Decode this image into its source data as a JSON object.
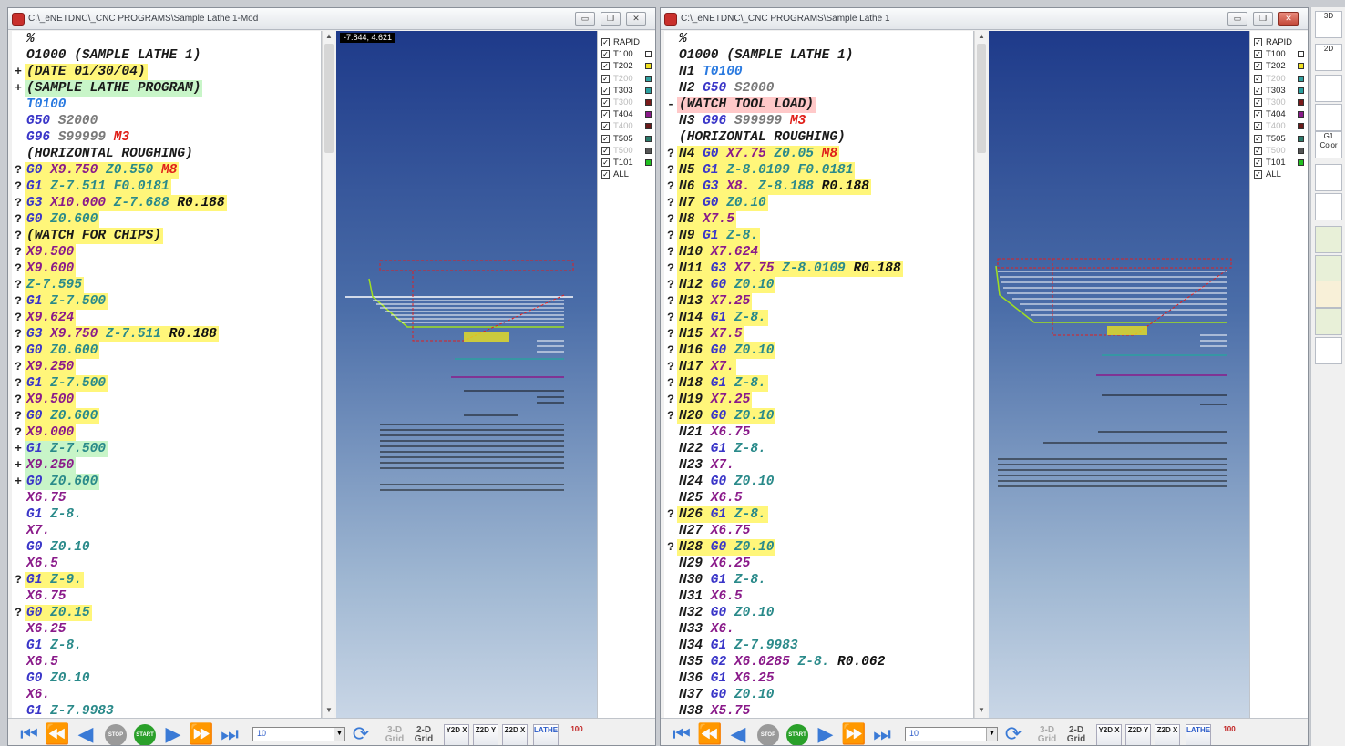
{
  "left": {
    "title": "C:\\_eNETDNC\\_CNC PROGRAMS\\Sample Lathe 1-Mod",
    "coord": "-7.844, 4.621",
    "code": [
      {
        "g": "",
        "t": [
          [
            "%",
            "t"
          ]
        ]
      },
      {
        "g": "",
        "t": [
          [
            "O1000 (SAMPLE LATHE 1)",
            "t"
          ]
        ]
      },
      {
        "g": "+",
        "h": "yellow",
        "t": [
          [
            "(DATE 01/30/04)",
            "t"
          ]
        ]
      },
      {
        "g": "+",
        "h": "green",
        "t": [
          [
            "(SAMPLE LATHE PROGRAM)",
            "t"
          ]
        ]
      },
      {
        "g": "",
        "t": [
          [
            "T0100",
            "tool"
          ]
        ]
      },
      {
        "g": "",
        "t": [
          [
            "G50",
            "g"
          ],
          [
            " S2000",
            "s"
          ]
        ]
      },
      {
        "g": "",
        "t": [
          [
            "G96",
            "g"
          ],
          [
            " S99999",
            "s"
          ],
          [
            " M3",
            "m"
          ]
        ]
      },
      {
        "g": "",
        "t": [
          [
            "(HORIZONTAL ROUGHING)",
            "t"
          ]
        ]
      },
      {
        "g": "?",
        "h": "yellow",
        "t": [
          [
            "G0",
            "g"
          ],
          [
            " X9.750",
            "x"
          ],
          [
            " Z0.550",
            "z"
          ],
          [
            " M8",
            "m"
          ]
        ]
      },
      {
        "g": "?",
        "h": "yellow",
        "t": [
          [
            "G1",
            "g"
          ],
          [
            " Z-7.511",
            "z"
          ],
          [
            " F0.0181",
            "f"
          ]
        ]
      },
      {
        "g": "?",
        "h": "yellow",
        "t": [
          [
            "G3",
            "g"
          ],
          [
            " X10.000",
            "x"
          ],
          [
            " Z-7.688",
            "z"
          ],
          [
            " R0.188",
            "r"
          ]
        ]
      },
      {
        "g": "?",
        "h": "yellow",
        "t": [
          [
            "G0",
            "g"
          ],
          [
            " Z0.600",
            "z"
          ]
        ]
      },
      {
        "g": "?",
        "h": "yellow",
        "t": [
          [
            "(WATCH FOR CHIPS)",
            "t"
          ]
        ]
      },
      {
        "g": "?",
        "h": "yellow",
        "t": [
          [
            "X9.500",
            "x"
          ]
        ]
      },
      {
        "g": "?",
        "h": "yellow",
        "t": [
          [
            "X9.600",
            "x"
          ]
        ]
      },
      {
        "g": "?",
        "h": "yellow",
        "t": [
          [
            "Z-7.595",
            "z"
          ]
        ]
      },
      {
        "g": "?",
        "h": "yellow",
        "t": [
          [
            "G1",
            "g"
          ],
          [
            " Z-7.500",
            "z"
          ]
        ]
      },
      {
        "g": "?",
        "h": "yellow",
        "t": [
          [
            "X9.624",
            "x"
          ]
        ]
      },
      {
        "g": "?",
        "h": "yellow",
        "t": [
          [
            "G3",
            "g"
          ],
          [
            " X9.750",
            "x"
          ],
          [
            " Z-7.511",
            "z"
          ],
          [
            " R0.188",
            "r"
          ]
        ]
      },
      {
        "g": "?",
        "h": "yellow",
        "t": [
          [
            "G0",
            "g"
          ],
          [
            " Z0.600",
            "z"
          ]
        ]
      },
      {
        "g": "?",
        "h": "yellow",
        "t": [
          [
            "X9.250",
            "x"
          ]
        ]
      },
      {
        "g": "?",
        "h": "yellow",
        "t": [
          [
            "G1",
            "g"
          ],
          [
            " Z-7.500",
            "z"
          ]
        ]
      },
      {
        "g": "?",
        "h": "yellow",
        "t": [
          [
            "X9.500",
            "x"
          ]
        ]
      },
      {
        "g": "?",
        "h": "yellow",
        "t": [
          [
            "G0",
            "g"
          ],
          [
            " Z0.600",
            "z"
          ]
        ]
      },
      {
        "g": "?",
        "h": "yellow",
        "t": [
          [
            "X9.000",
            "x"
          ]
        ]
      },
      {
        "g": "+",
        "h": "green",
        "t": [
          [
            "G1",
            "g"
          ],
          [
            " Z-7.500",
            "z"
          ]
        ]
      },
      {
        "g": "+",
        "h": "green",
        "t": [
          [
            "X9.250",
            "x"
          ]
        ]
      },
      {
        "g": "+",
        "h": "green",
        "t": [
          [
            "G0",
            "g"
          ],
          [
            " Z0.600",
            "z"
          ]
        ]
      },
      {
        "g": "",
        "t": [
          [
            "X6.75",
            "x"
          ]
        ]
      },
      {
        "g": "",
        "t": [
          [
            "G1",
            "g"
          ],
          [
            " Z-8.",
            "z"
          ]
        ]
      },
      {
        "g": "",
        "t": [
          [
            "X7.",
            "x"
          ]
        ]
      },
      {
        "g": "",
        "t": [
          [
            "G0",
            "g"
          ],
          [
            " Z0.10",
            "z"
          ]
        ]
      },
      {
        "g": "",
        "t": [
          [
            "X6.5",
            "x"
          ]
        ]
      },
      {
        "g": "?",
        "h": "yellow",
        "t": [
          [
            "G1",
            "g"
          ],
          [
            " Z-9.",
            "z"
          ]
        ]
      },
      {
        "g": "",
        "t": [
          [
            "X6.75",
            "x"
          ]
        ]
      },
      {
        "g": "?",
        "h": "yellow",
        "t": [
          [
            "G0",
            "g"
          ],
          [
            " Z0.15",
            "z"
          ]
        ]
      },
      {
        "g": "",
        "t": [
          [
            "X6.25",
            "x"
          ]
        ]
      },
      {
        "g": "",
        "t": [
          [
            "G1",
            "g"
          ],
          [
            " Z-8.",
            "z"
          ]
        ]
      },
      {
        "g": "",
        "t": [
          [
            "X6.5",
            "x"
          ]
        ]
      },
      {
        "g": "",
        "t": [
          [
            "G0",
            "g"
          ],
          [
            " Z0.10",
            "z"
          ]
        ]
      },
      {
        "g": "",
        "t": [
          [
            "X6.",
            "x"
          ]
        ]
      },
      {
        "g": "",
        "t": [
          [
            "G1",
            "g"
          ],
          [
            " Z-7.9983",
            "z"
          ]
        ]
      }
    ]
  },
  "right": {
    "title": "C:\\_eNETDNC\\_CNC PROGRAMS\\Sample Lathe 1",
    "code": [
      {
        "g": "",
        "t": [
          [
            "%",
            "t"
          ]
        ]
      },
      {
        "g": "",
        "t": [
          [
            "O1000 (SAMPLE LATHE 1)",
            "t"
          ]
        ]
      },
      {
        "g": "",
        "t": [
          [
            "N1",
            "n"
          ],
          [
            " T0100",
            "tool"
          ]
        ]
      },
      {
        "g": "",
        "t": [
          [
            "N2",
            "n"
          ],
          [
            " G50",
            "g"
          ],
          [
            " S2000",
            "s"
          ]
        ]
      },
      {
        "g": "-",
        "h": "red",
        "t": [
          [
            "(WATCH TOOL LOAD)",
            "t"
          ]
        ]
      },
      {
        "g": "",
        "t": [
          [
            "N3",
            "n"
          ],
          [
            " G96",
            "g"
          ],
          [
            " S99999",
            "s"
          ],
          [
            " M3",
            "m"
          ]
        ]
      },
      {
        "g": "",
        "t": [
          [
            "(HORIZONTAL ROUGHING)",
            "t"
          ]
        ]
      },
      {
        "g": "?",
        "h": "yellow",
        "t": [
          [
            "N4",
            "n"
          ],
          [
            " G0",
            "g"
          ],
          [
            " X7.75",
            "x"
          ],
          [
            " Z0.05",
            "z"
          ],
          [
            " M8",
            "m"
          ]
        ]
      },
      {
        "g": "?",
        "h": "yellow",
        "t": [
          [
            "N5",
            "n"
          ],
          [
            " G1",
            "g"
          ],
          [
            " Z-8.0109",
            "z"
          ],
          [
            " F0.0181",
            "f"
          ]
        ]
      },
      {
        "g": "?",
        "h": "yellow",
        "t": [
          [
            "N6",
            "n"
          ],
          [
            " G3",
            "g"
          ],
          [
            " X8.",
            "x"
          ],
          [
            " Z-8.188",
            "z"
          ],
          [
            " R0.188",
            "r"
          ]
        ]
      },
      {
        "g": "?",
        "h": "yellow",
        "t": [
          [
            "N7",
            "n"
          ],
          [
            " G0",
            "g"
          ],
          [
            " Z0.10",
            "z"
          ]
        ]
      },
      {
        "g": "?",
        "h": "yellow",
        "t": [
          [
            "N8",
            "n"
          ],
          [
            " X7.5",
            "x"
          ]
        ]
      },
      {
        "g": "?",
        "h": "yellow",
        "t": [
          [
            "N9",
            "n"
          ],
          [
            " G1",
            "g"
          ],
          [
            " Z-8.",
            "z"
          ]
        ]
      },
      {
        "g": "?",
        "h": "yellow",
        "t": [
          [
            "N10",
            "n"
          ],
          [
            " X7.624",
            "x"
          ]
        ]
      },
      {
        "g": "?",
        "h": "yellow",
        "t": [
          [
            "N11",
            "n"
          ],
          [
            " G3",
            "g"
          ],
          [
            " X7.75",
            "x"
          ],
          [
            " Z-8.0109",
            "z"
          ],
          [
            " R0.188",
            "r"
          ]
        ]
      },
      {
        "g": "?",
        "h": "yellow",
        "t": [
          [
            "N12",
            "n"
          ],
          [
            " G0",
            "g"
          ],
          [
            " Z0.10",
            "z"
          ]
        ]
      },
      {
        "g": "?",
        "h": "yellow",
        "t": [
          [
            "N13",
            "n"
          ],
          [
            " X7.25",
            "x"
          ]
        ]
      },
      {
        "g": "?",
        "h": "yellow",
        "t": [
          [
            "N14",
            "n"
          ],
          [
            " G1",
            "g"
          ],
          [
            " Z-8.",
            "z"
          ]
        ]
      },
      {
        "g": "?",
        "h": "yellow",
        "t": [
          [
            "N15",
            "n"
          ],
          [
            " X7.5",
            "x"
          ]
        ]
      },
      {
        "g": "?",
        "h": "yellow",
        "t": [
          [
            "N16",
            "n"
          ],
          [
            " G0",
            "g"
          ],
          [
            " Z0.10",
            "z"
          ]
        ]
      },
      {
        "g": "?",
        "h": "yellow",
        "t": [
          [
            "N17",
            "n"
          ],
          [
            " X7.",
            "x"
          ]
        ]
      },
      {
        "g": "?",
        "h": "yellow",
        "t": [
          [
            "N18",
            "n"
          ],
          [
            " G1",
            "g"
          ],
          [
            " Z-8.",
            "z"
          ]
        ]
      },
      {
        "g": "?",
        "h": "yellow",
        "t": [
          [
            "N19",
            "n"
          ],
          [
            " X7.25",
            "x"
          ]
        ]
      },
      {
        "g": "?",
        "h": "yellow",
        "t": [
          [
            "N20",
            "n"
          ],
          [
            " G0",
            "g"
          ],
          [
            " Z0.10",
            "z"
          ]
        ]
      },
      {
        "g": "",
        "t": [
          [
            "N21",
            "n"
          ],
          [
            " X6.75",
            "x"
          ]
        ]
      },
      {
        "g": "",
        "t": [
          [
            "N22",
            "n"
          ],
          [
            " G1",
            "g"
          ],
          [
            " Z-8.",
            "z"
          ]
        ]
      },
      {
        "g": "",
        "t": [
          [
            "N23",
            "n"
          ],
          [
            " X7.",
            "x"
          ]
        ]
      },
      {
        "g": "",
        "t": [
          [
            "N24",
            "n"
          ],
          [
            " G0",
            "g"
          ],
          [
            " Z0.10",
            "z"
          ]
        ]
      },
      {
        "g": "",
        "t": [
          [
            "N25",
            "n"
          ],
          [
            " X6.5",
            "x"
          ]
        ]
      },
      {
        "g": "?",
        "h": "yellow",
        "t": [
          [
            "N26",
            "n"
          ],
          [
            " G1",
            "g"
          ],
          [
            " Z-8.",
            "z"
          ]
        ]
      },
      {
        "g": "",
        "t": [
          [
            "N27",
            "n"
          ],
          [
            " X6.75",
            "x"
          ]
        ]
      },
      {
        "g": "?",
        "h": "yellow",
        "t": [
          [
            "N28",
            "n"
          ],
          [
            " G0",
            "g"
          ],
          [
            " Z0.10",
            "z"
          ]
        ]
      },
      {
        "g": "",
        "t": [
          [
            "N29",
            "n"
          ],
          [
            " X6.25",
            "x"
          ]
        ]
      },
      {
        "g": "",
        "t": [
          [
            "N30",
            "n"
          ],
          [
            " G1",
            "g"
          ],
          [
            " Z-8.",
            "z"
          ]
        ]
      },
      {
        "g": "",
        "t": [
          [
            "N31",
            "n"
          ],
          [
            " X6.5",
            "x"
          ]
        ]
      },
      {
        "g": "",
        "t": [
          [
            "N32",
            "n"
          ],
          [
            " G0",
            "g"
          ],
          [
            " Z0.10",
            "z"
          ]
        ]
      },
      {
        "g": "",
        "t": [
          [
            "N33",
            "n"
          ],
          [
            " X6.",
            "x"
          ]
        ]
      },
      {
        "g": "",
        "t": [
          [
            "N34",
            "n"
          ],
          [
            " G1",
            "g"
          ],
          [
            " Z-7.9983",
            "z"
          ]
        ]
      },
      {
        "g": "",
        "t": [
          [
            "N35",
            "n"
          ],
          [
            " G2",
            "g"
          ],
          [
            " X6.0285",
            "x"
          ],
          [
            " Z-8.",
            "z"
          ],
          [
            " R0.062",
            "r"
          ]
        ]
      },
      {
        "g": "",
        "t": [
          [
            "N36",
            "n"
          ],
          [
            " G1",
            "g"
          ],
          [
            " X6.25",
            "x"
          ]
        ]
      },
      {
        "g": "",
        "t": [
          [
            "N37",
            "n"
          ],
          [
            " G0",
            "g"
          ],
          [
            " Z0.10",
            "z"
          ]
        ]
      },
      {
        "g": "",
        "t": [
          [
            "N38",
            "n"
          ],
          [
            " X5.75",
            "x"
          ]
        ]
      }
    ]
  },
  "tools": [
    {
      "label": "RAPID",
      "checked": true,
      "dim": false,
      "color": ""
    },
    {
      "label": "T100",
      "checked": true,
      "dim": false,
      "color": "#ffffff"
    },
    {
      "label": "T202",
      "checked": true,
      "dim": false,
      "color": "#f0e020"
    },
    {
      "label": "T200",
      "checked": true,
      "dim": true,
      "color": "#30a0a0"
    },
    {
      "label": "T303",
      "checked": true,
      "dim": false,
      "color": "#2aa0a0"
    },
    {
      "label": "T300",
      "checked": true,
      "dim": true,
      "color": "#7a1a1a"
    },
    {
      "label": "T404",
      "checked": true,
      "dim": false,
      "color": "#8a1a8a"
    },
    {
      "label": "T400",
      "checked": true,
      "dim": true,
      "color": "#6a1a1a"
    },
    {
      "label": "T505",
      "checked": true,
      "dim": false,
      "color": "#2a7a6a"
    },
    {
      "label": "T500",
      "checked": true,
      "dim": true,
      "color": "#555555"
    },
    {
      "label": "T101",
      "checked": true,
      "dim": false,
      "color": "#20c020"
    },
    {
      "label": "ALL",
      "checked": true,
      "dim": false,
      "color": ""
    }
  ],
  "bottom": {
    "stop": "STOP",
    "start": "START",
    "combo": "10",
    "grid3d": "3-D Grid",
    "grid2d": "2-D Grid",
    "yx": "Y2D X",
    "zy": "Z2D Y",
    "zx": "Z2D X",
    "lathe": "LATHE",
    "zoom": "100"
  },
  "rtools": [
    "3D",
    "2D",
    "",
    "",
    "G1 Color",
    "",
    "",
    "",
    "",
    "",
    "",
    ""
  ]
}
